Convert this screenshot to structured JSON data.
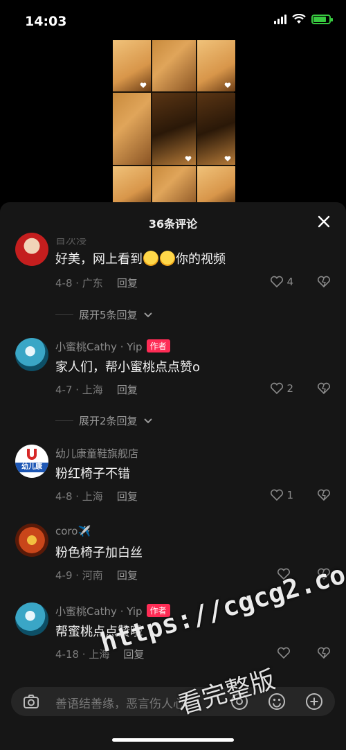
{
  "status_bar": {
    "time": "14:03"
  },
  "sheet": {
    "title": "36条评论"
  },
  "comments": [
    {
      "username": "首次浸",
      "text_before": "好美，网上看到",
      "text_after": "你的视频",
      "date_location": "4-8 · 广东",
      "reply": "回复",
      "likes": "4"
    },
    {
      "username": "小蜜桃Cathy · Yip",
      "author_tag": "作者",
      "text": "家人们，帮小蜜桃点点赞o",
      "date_location": "4-7 · 上海",
      "reply": "回复",
      "likes": "2"
    },
    {
      "username": "幼儿康童鞋旗舰店",
      "avatar_text": "幼儿康",
      "text": "粉红椅子不错",
      "date_location": "4-8 · 上海",
      "reply": "回复",
      "likes": "1"
    },
    {
      "username": "coro✈️",
      "text": "粉色椅子加白丝",
      "date_location": "4-9 · 河南",
      "reply": "回复",
      "likes": ""
    },
    {
      "username": "小蜜桃Cathy · Yip",
      "author_tag": "作者",
      "text": "帮蜜桃点点赞哦",
      "date_location": "4-18 · 上海",
      "reply": "回复",
      "likes": ""
    }
  ],
  "expand_replies": [
    "展开5条回复",
    "展开2条回复"
  ],
  "input": {
    "placeholder": "善语结善缘，恶言伤人心"
  },
  "watermark": {
    "url": "https://cgcg2.co",
    "cta": "看完整版"
  },
  "colors": {
    "author_tag": "#fe2c55",
    "battery": "#38c940",
    "sheet_bg": "#161616"
  },
  "icons": [
    "camera-icon",
    "at-icon",
    "emoji-icon",
    "plus-icon",
    "heart-icon",
    "dislike-icon",
    "close-icon",
    "wifi-icon",
    "signal-icon",
    "battery-icon"
  ]
}
